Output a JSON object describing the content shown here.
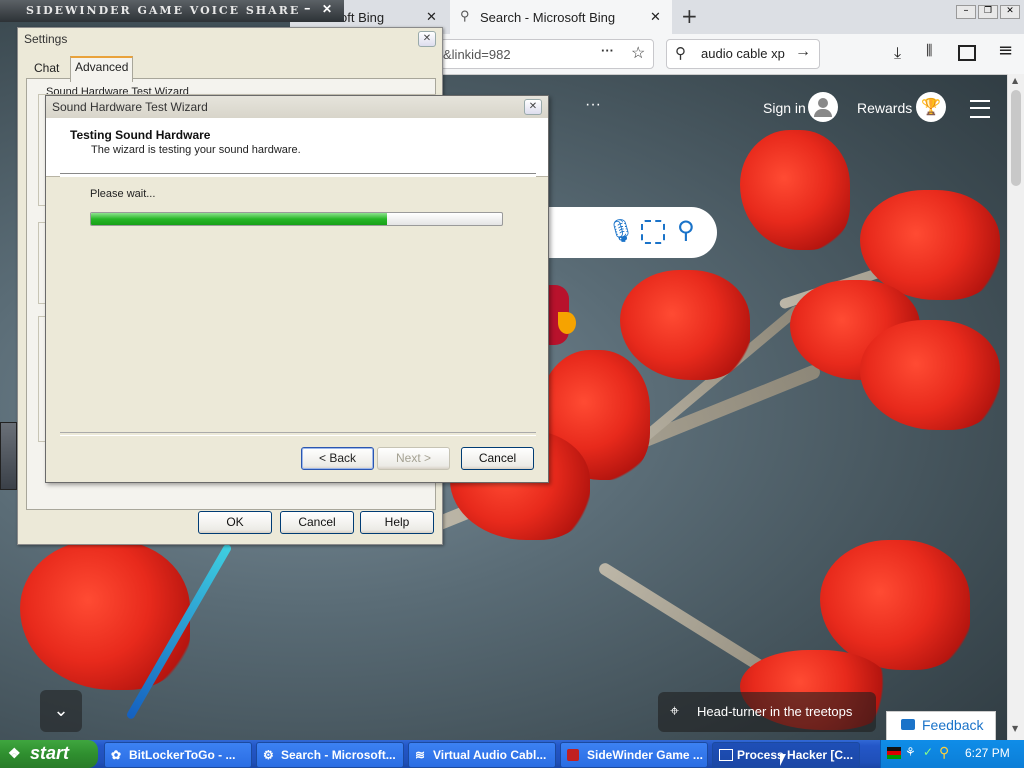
{
  "game_voice": {
    "title": "SIDEWINDER GAME VOICE SHARE",
    "min": "–",
    "close": "✕"
  },
  "browser": {
    "tabs": [
      {
        "label": "oft Bing",
        "close": "✕"
      },
      {
        "label": "Search - Microsoft Bing",
        "close": "✕"
      }
    ],
    "new_tab": "+",
    "url_text": "&linkid=982",
    "url_more": "···",
    "search_value": "audio cable xp",
    "window_controls": {
      "min": "–",
      "max": "❐",
      "close": "✕"
    }
  },
  "bing": {
    "dots": "···",
    "sign_in": "Sign in",
    "rewards": "Rewards",
    "caption": "Head-turner in the treetops",
    "feedback": "Feedback"
  },
  "settings": {
    "title": "Settings",
    "close": "✕",
    "tabs": [
      {
        "label": "Chat"
      },
      {
        "label": "Advanced"
      }
    ],
    "group_label": "Sound Hardware Test Wizard",
    "ok": "OK",
    "cancel": "Cancel",
    "help": "Help"
  },
  "wizard": {
    "title": "Sound Hardware Test Wizard",
    "close": "✕",
    "heading": "Testing Sound Hardware",
    "subheading": "The wizard is testing your sound hardware.",
    "wait_text": "Please wait...",
    "progress": 0.72,
    "back": "< Back",
    "next": "Next >",
    "cancel": "Cancel"
  },
  "taskbar": {
    "start": "start",
    "items": [
      {
        "label": "BitLockerToGo - ..."
      },
      {
        "label": "Search - Microsoft..."
      },
      {
        "label": "Virtual Audio Cabl..."
      },
      {
        "label": "SideWinder Game ..."
      },
      {
        "label": "Process Hacker [C..."
      }
    ],
    "clock": "6:27 PM"
  },
  "colors": {
    "accent_green": "#27b627",
    "taskbar_blue": "#2457c8",
    "start_green": "#2f8f2f"
  }
}
